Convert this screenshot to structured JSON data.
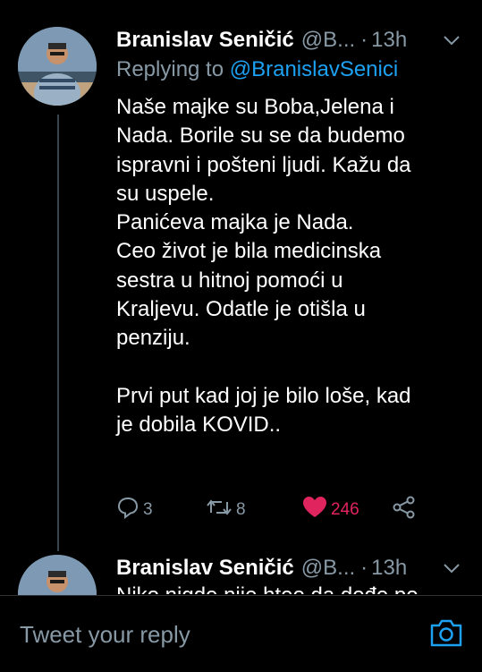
{
  "tweets": [
    {
      "name": "Branislav Seničić",
      "handle": "@B...",
      "separator": "·",
      "time": "13h",
      "replying_label": "Replying to",
      "replying_to": "@BranislavSenici",
      "lines": [
        "Naše majke su Boba,Jelena i",
        "Nada. Borile su se da budemo",
        "ispravni i pošteni ljudi. Kažu da",
        "su uspele.",
        "Panićeva majka je Nada.",
        "Ceo život je bila medicinska",
        "sestra u hitnoj pomoći u",
        "Kraljevu. Odatle je otišla u",
        "penziju.",
        "",
        "Prvi put kad joj je bilo loše, kad",
        "je dobila KOVID.."
      ],
      "replies": "3",
      "retweets": "8",
      "likes": "246"
    },
    {
      "name": "Branislav Seničić",
      "handle": "@B...",
      "separator": "·",
      "time": "13h",
      "partial_text": "Niko nigde nije htео da dođe po"
    }
  ],
  "reply_bar": {
    "placeholder": "Tweet your reply"
  },
  "colors": {
    "background": "#000000",
    "text": "#ffffff",
    "secondary": "#8899a6",
    "link": "#1da1f2",
    "like": "#e0245e"
  },
  "icons": [
    "chevron-down-icon",
    "reply-icon",
    "retweet-icon",
    "heart-icon",
    "share-icon",
    "camera-icon"
  ]
}
